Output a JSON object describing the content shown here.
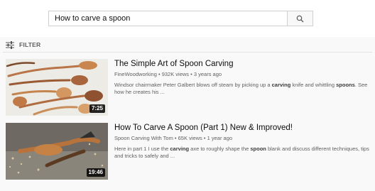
{
  "search": {
    "query": "How to carve a spoon"
  },
  "filter": {
    "label": "FILTER"
  },
  "results": [
    {
      "title": "The Simple Art of Spoon Carving",
      "channel": "FineWoodworking",
      "views": "932K views",
      "age": "3 years ago",
      "duration": "7:25",
      "desc_1": "Windsor chairmaker Peter Galbert blows off steam by picking up a ",
      "desc_2": "carving",
      "desc_3": " knife and whittling ",
      "desc_4": "spoons",
      "desc_5": ". See how he creates his ..."
    },
    {
      "title": "How To Carve A Spoon (Part 1) New & Improved!",
      "channel": "Spoon Carving With Tom",
      "views": "65K views",
      "age": "1 year ago",
      "duration": "19:46",
      "desc_1": "Here in part 1 I use the ",
      "desc_2": "carving",
      "desc_3": " axe to roughly shape the ",
      "desc_4": "spoon",
      "desc_5": " blank and discuss different techniques, tips and tricks to safely and ..."
    }
  ],
  "icons": {
    "search": "search-icon",
    "filter": "filter-icon"
  }
}
